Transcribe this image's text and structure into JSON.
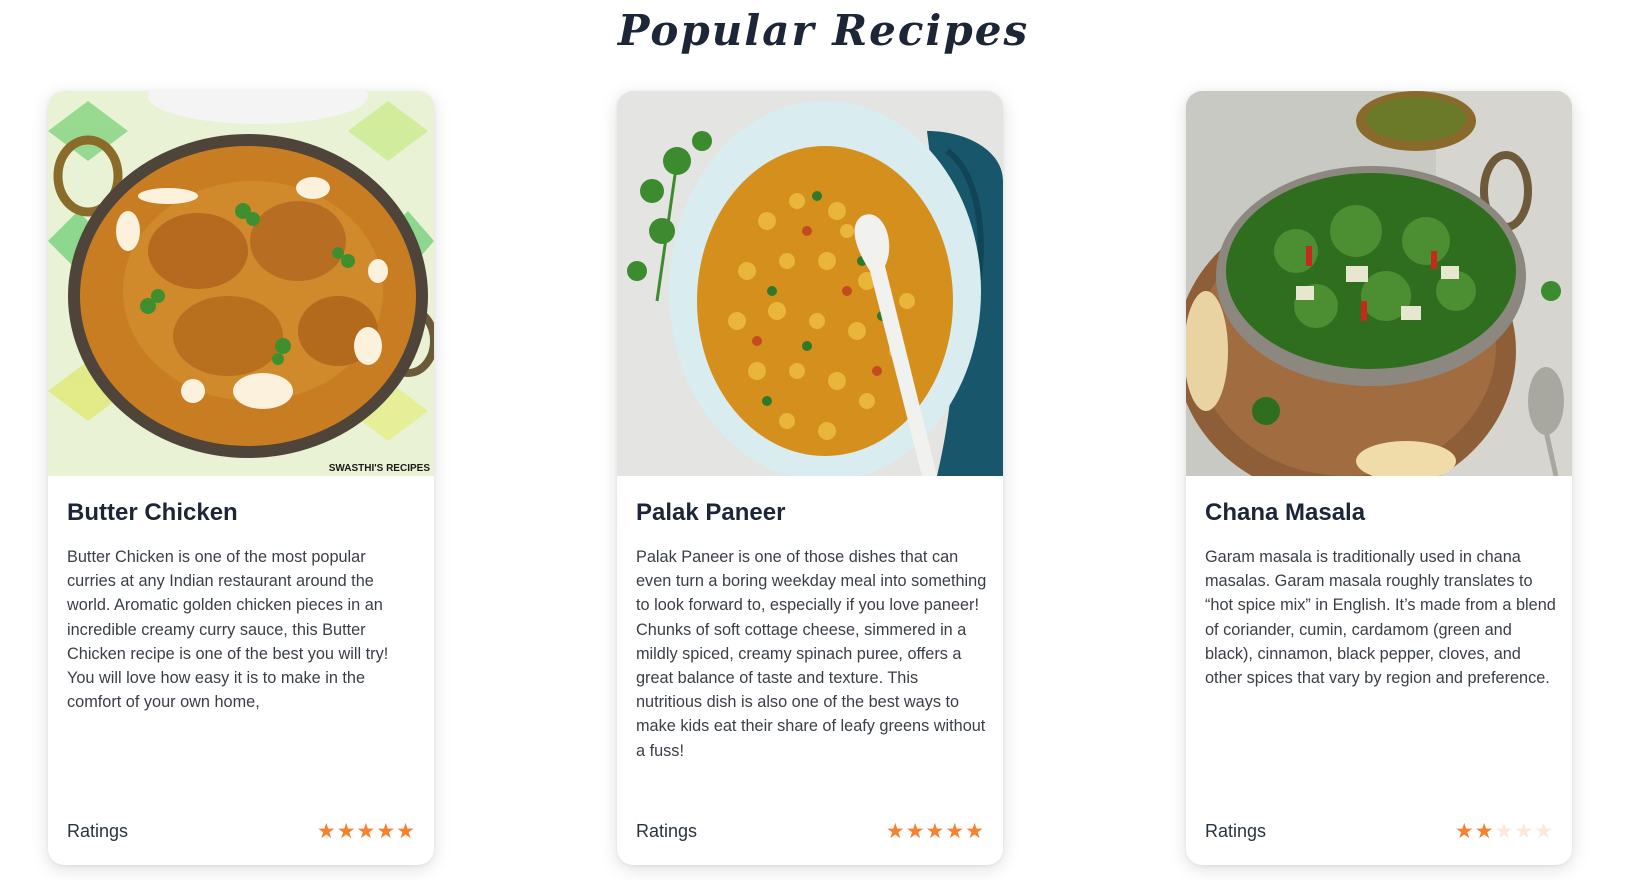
{
  "page": {
    "title": "Popular Recipes"
  },
  "colors": {
    "star_on": "#f5822e",
    "star_off": "#fde9dc",
    "title": "#1c2637"
  },
  "recipes": [
    {
      "name": "Butter Chicken",
      "description": "Butter Chicken is one of the most popular curries at any Indian restaurant around the world. Aromatic golden chicken pieces in an incredible creamy curry sauce, this Butter Chicken recipe is one of the best you will try! You will love how easy it is to make in the comfort of your own home,",
      "image_watermark": "SWASTHI'S RECIPES",
      "ratings_label": "Ratings",
      "rating": 5,
      "rating_max": 5
    },
    {
      "name": "Palak Paneer",
      "description": "Palak Paneer is one of those dishes that can even turn a boring weekday meal into something to look forward to, especially if you love paneer! Chunks of soft cottage cheese, simmered in a mildly spiced, creamy spinach puree, offers a great balance of taste and texture. This nutritious dish is also one of the best ways to make kids eat their share of leafy greens without a fuss!",
      "ratings_label": "Ratings",
      "rating": 5,
      "rating_max": 5
    },
    {
      "name": "Chana Masala",
      "description": "Garam masala is traditionally used in chana masalas. Garam masala roughly translates to “hot spice mix” in English. It’s made from a blend of coriander, cumin, cardamom (green and black), cinnamon, black pepper, cloves, and other spices that vary by region and preference.",
      "ratings_label": "Ratings",
      "rating": 2,
      "rating_max": 5
    }
  ]
}
